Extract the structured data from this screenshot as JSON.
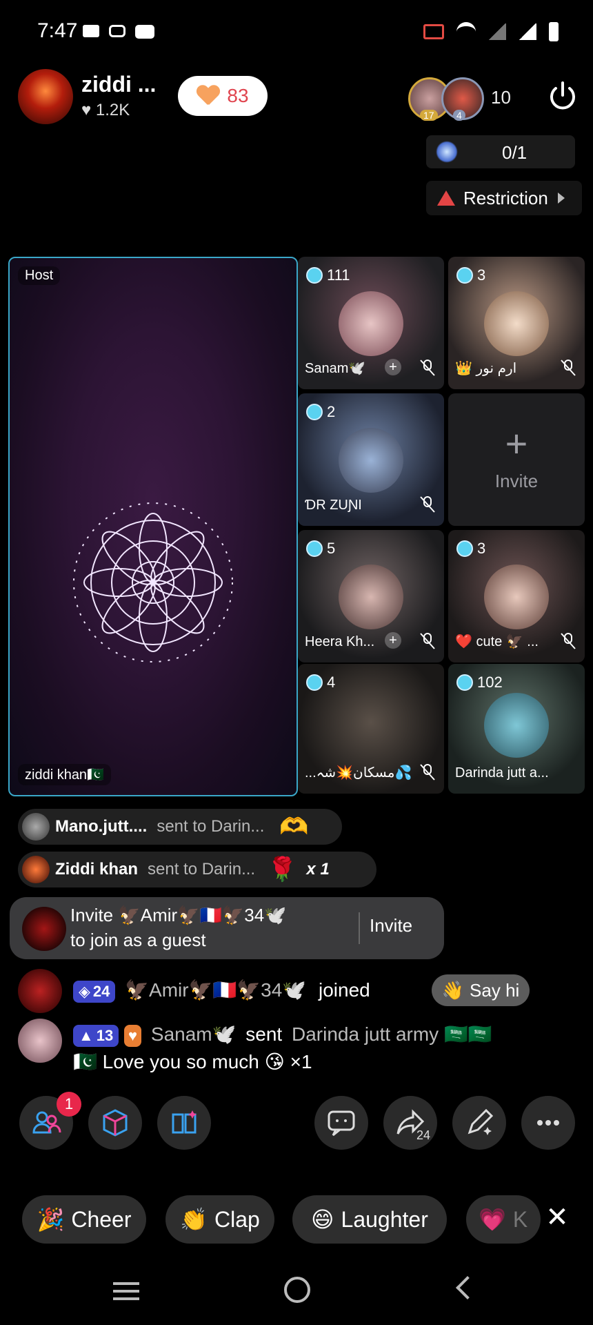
{
  "status_bar": {
    "time": "7:47"
  },
  "header": {
    "host_name": "ziddi ...",
    "host_likes": "♥ 1.2K",
    "like_count": "83",
    "viewer_badges": [
      "17",
      "4"
    ],
    "viewer_count": "10",
    "seat_counter": "0/1",
    "restriction_label": "Restriction"
  },
  "host_tile": {
    "label": "Host",
    "name": "ziddi khan🇵🇰"
  },
  "seats": [
    {
      "score": "111",
      "name": "Sanam🕊️",
      "has_plus": true
    },
    {
      "score": "3",
      "name": "👑 ارم نور",
      "has_plus": false
    },
    {
      "score": "2",
      "name": "ƊR ZUƝI",
      "has_plus": false
    },
    {
      "score": "5",
      "name": "Heera Kh...",
      "has_plus": true
    },
    {
      "score": "3",
      "name": "❤️ cute 🦅 ...",
      "has_plus": false
    },
    {
      "score": "4",
      "name": "...مسکان💥شہ💦",
      "has_plus": false
    },
    {
      "score": "102",
      "name": "Darinda jutt a...",
      "has_plus": false
    }
  ],
  "invite_seat": {
    "plus": "+",
    "label": "Invite"
  },
  "gift_rows": [
    {
      "sender": "Mano.jutt....",
      "text": "sent to Darin...",
      "gift": "🫶",
      "count": ""
    },
    {
      "sender": "Ziddi khan",
      "text": "sent to Darin...",
      "gift": "🌹",
      "count": "x 1"
    }
  ],
  "invite_banner": {
    "line1": "Invite 🦅Amir🦅🇫🇷🦅34🕊️",
    "line2": "to join as a guest",
    "button": "Invite"
  },
  "chat": [
    {
      "level": "24",
      "name": "🦅Amir🦅🇫🇷🦅34🕊️",
      "action": "joined"
    },
    {
      "level": "13",
      "name": "Sanam🕊️",
      "action": "sent",
      "target": "Darinda jutt army 🇸🇦🇸🇦",
      "message": "🇵🇰 Love you so much 😘 ×1"
    }
  ],
  "say_hi": "Say hi",
  "toolbar": {
    "notification_count": "1",
    "share_count": "24"
  },
  "reactions": [
    "Cheer",
    "Clap",
    "Laughter",
    "K"
  ],
  "colors": {
    "accent": "#3aa8c9",
    "like_red": "#e0454f",
    "badge_blue": "#3e46c9",
    "notif_red": "#e8274b"
  }
}
